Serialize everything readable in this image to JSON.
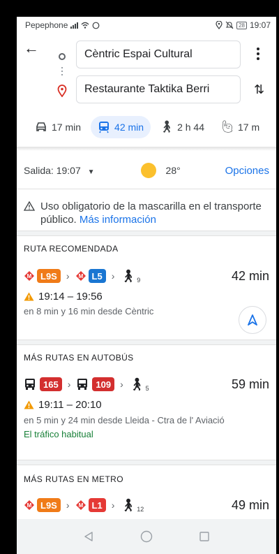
{
  "status_bar": {
    "carrier": "Pepephone",
    "battery": "28",
    "time": "19:07"
  },
  "search": {
    "origin": "Cèntric Espai Cultural",
    "destination": "Restaurante Taktika Berri"
  },
  "modes": [
    {
      "name": "car",
      "label": "17 min",
      "selected": false
    },
    {
      "name": "transit",
      "label": "42 min",
      "selected": true
    },
    {
      "name": "walk",
      "label": "2 h 44",
      "selected": false
    },
    {
      "name": "ride",
      "label": "17 m",
      "selected": false
    }
  ],
  "departure": {
    "label": "Salida: 19:07",
    "temperature": "28°",
    "options": "Opciones"
  },
  "notice": {
    "text": "Uso obligatorio de la mascarilla en el transporte público.",
    "link": "Más información"
  },
  "sections": [
    {
      "title": "RUTA RECOMENDADA",
      "lines": [
        "L9S",
        "L5"
      ],
      "walk_minutes": "9",
      "duration": "42 min",
      "time_range": "19:14 – 19:56",
      "detail": "en 8 min y 16 min desde Cèntric"
    },
    {
      "title": "MÁS RUTAS EN AUTOBÚS",
      "lines": [
        "165",
        "109"
      ],
      "walk_minutes": "5",
      "duration": "59 min",
      "time_range": "19:11 – 20:10",
      "detail": "en 5 min y 24 min desde Lleida - Ctra de l' Aviació",
      "traffic": "El tráfico habitual"
    },
    {
      "title": "MÁS RUTAS EN METRO",
      "lines": [
        "L9S",
        "L1"
      ],
      "walk_minutes": "12",
      "duration": "49 min"
    }
  ],
  "colors": {
    "accent": "#1a73e8",
    "metro_red": "#e53935",
    "l9s_orange": "#f07b18",
    "l5_blue": "#1976d2",
    "l1_red": "#e53935",
    "bus_red": "#d32f2f",
    "warning": "#f29900",
    "traffic_green": "#188038"
  }
}
